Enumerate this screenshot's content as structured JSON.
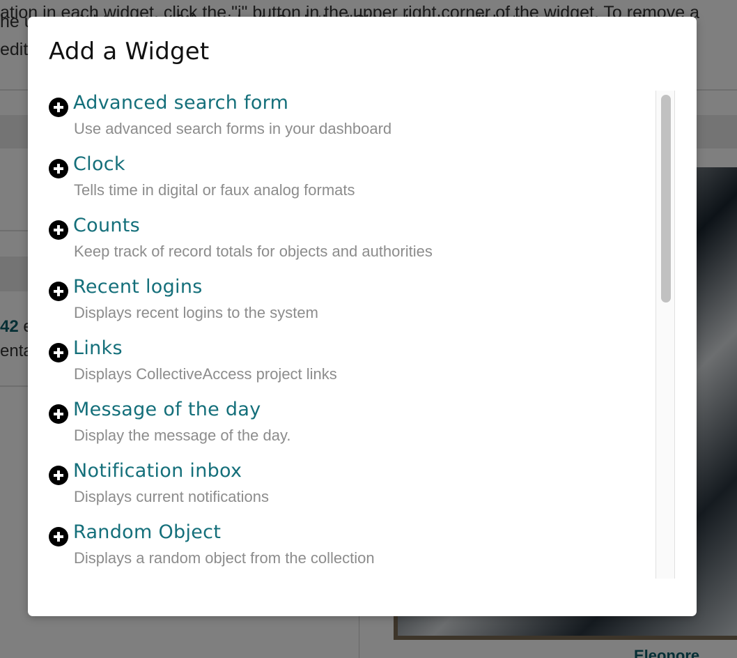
{
  "background": {
    "line1": "ation in each widget, click the \"i\" button in the upper right corner of the widget. To remove a",
    "line2": "he upper right corner of the widget. Click the \"Clear dashboard\" button to remove all",
    "line3": "editi",
    "count_value": "42",
    "count_suffix": " e",
    "line_enta": "enta",
    "person_name": "Eleonore"
  },
  "modal": {
    "title": "Add a Widget",
    "widgets": [
      {
        "name": "Advanced search form",
        "description": "Use advanced search forms in your dashboard"
      },
      {
        "name": "Clock",
        "description": "Tells time in digital or faux analog formats"
      },
      {
        "name": "Counts",
        "description": "Keep track of record totals for objects and authorities"
      },
      {
        "name": "Recent logins",
        "description": "Displays recent logins to the system"
      },
      {
        "name": "Links",
        "description": "Displays CollectiveAccess project links"
      },
      {
        "name": "Message of the day",
        "description": "Display the message of the day."
      },
      {
        "name": "Notification inbox",
        "description": "Displays current notifications"
      },
      {
        "name": "Random Object",
        "description": "Displays a random object from the collection"
      }
    ]
  },
  "icons": {
    "add": "plus-circle-icon"
  },
  "colors": {
    "link": "#146f7a",
    "description": "#8c8c8c",
    "overlay": "rgba(0,0,0,0.5)"
  }
}
